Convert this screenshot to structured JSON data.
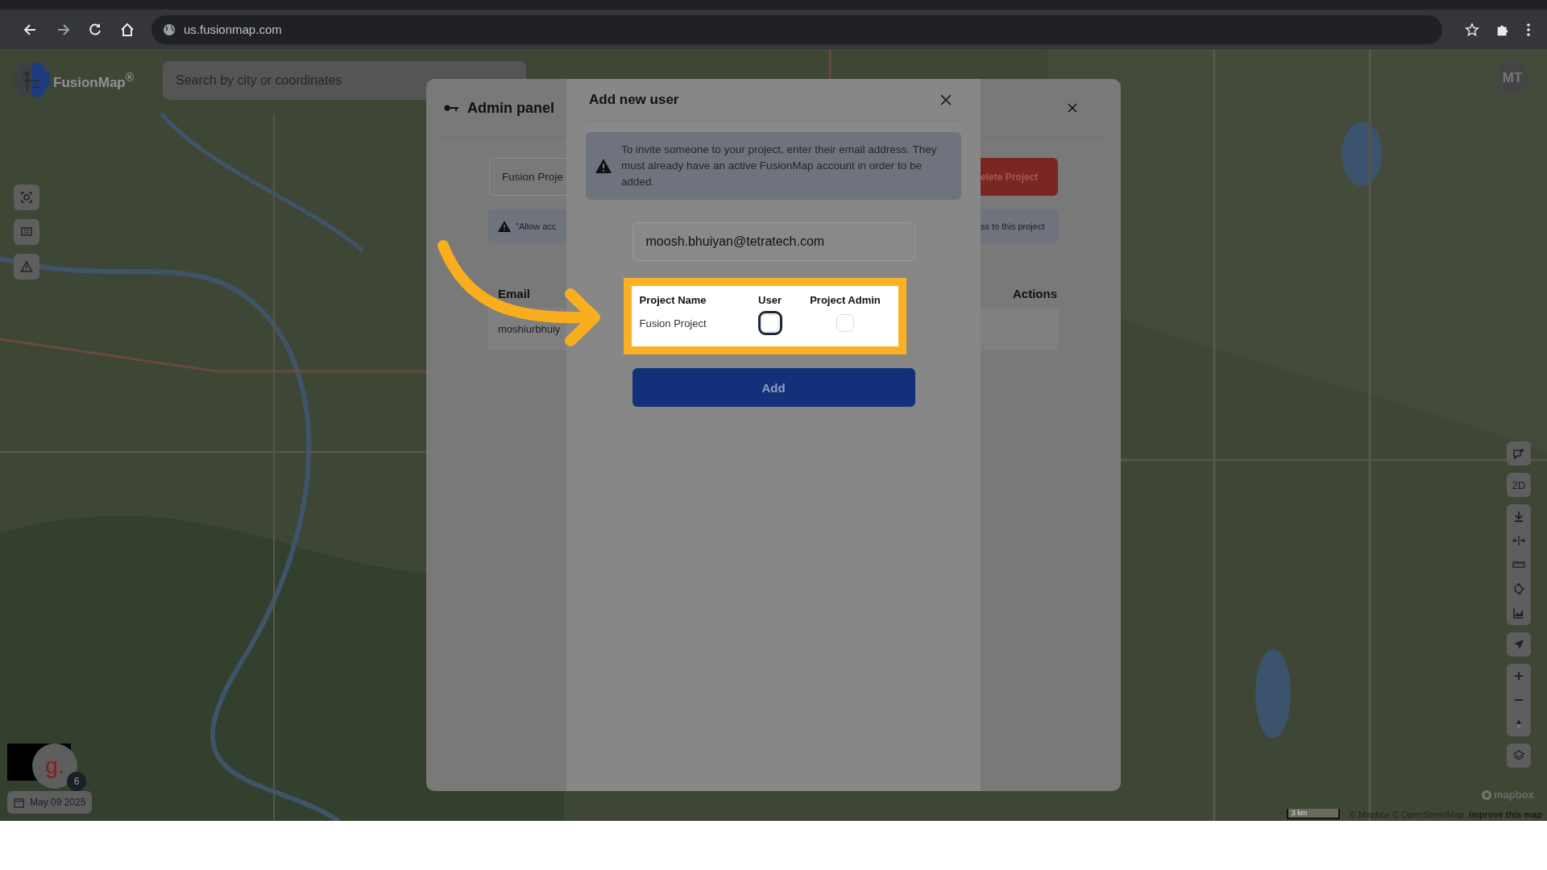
{
  "browser": {
    "url": "us.fusionmap.com"
  },
  "app": {
    "logo": "FusionMap$^{®}$",
    "search": {
      "placeholder": "Search by city or coordinates"
    },
    "avatar": "MT",
    "map_mode": "2D",
    "date": "May 09 2025",
    "widget": {
      "letter": "g.",
      "badge": "6"
    },
    "scale": "3 km",
    "attribution": "© Mapbox © OpenStreetMap",
    "improve_link": "Improve this map",
    "mapbox_logo": "mapbox"
  },
  "admin_panel": {
    "title": "Admin panel",
    "project_field": "Fusion Proje",
    "delete_button": "elete Project",
    "notice_left": "\"Allow acc",
    "notice_right": "ss to this project",
    "columns": [
      "Email",
      "Actions"
    ],
    "rows": [
      {
        "email": "moshiurbhuiy"
      }
    ]
  },
  "dialog": {
    "title": "Add new user",
    "info": "To invite someone to your project, enter their email address. They must already have an active FusionMap account in order to be added.",
    "email": "moosh.bhuiyan@tetratech.com",
    "columns": [
      "Project Name",
      "User",
      "Project Admin"
    ],
    "rows": [
      {
        "project": "Fusion Project",
        "user": {
          "checked": false,
          "focused": true
        },
        "admin": {
          "checked": false,
          "focused": false
        }
      }
    ],
    "button": "Add"
  }
}
